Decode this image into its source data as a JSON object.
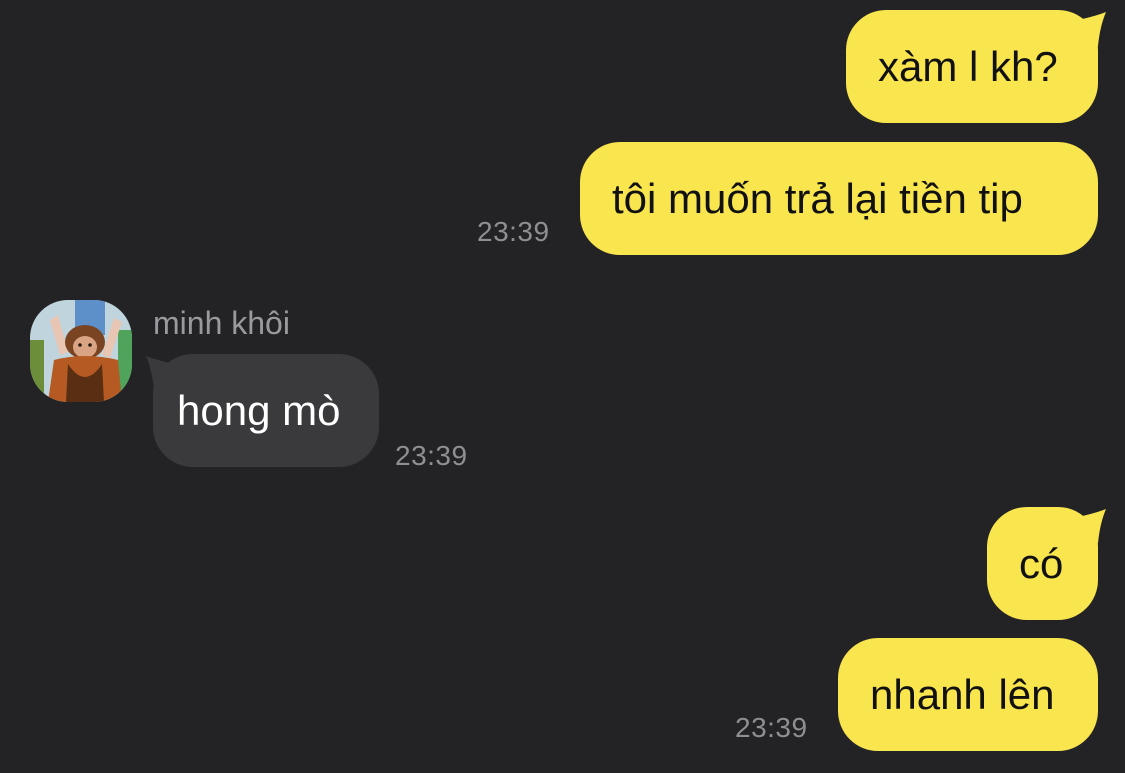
{
  "colors": {
    "background": "#232325",
    "outgoing_bubble": "#F9E54E",
    "incoming_bubble": "#3A3A3C",
    "timestamp": "#8E8E93"
  },
  "messages": [
    {
      "direction": "outgoing",
      "text": "xàm l kh?"
    },
    {
      "direction": "outgoing",
      "text": "tôi muốn trả lại tiền tip",
      "time": "23:39"
    },
    {
      "direction": "incoming",
      "sender": "minh khôi",
      "avatar_icon": "child-in-costume-avatar",
      "text": "hong mò",
      "time": "23:39"
    },
    {
      "direction": "outgoing",
      "text": "có"
    },
    {
      "direction": "outgoing",
      "text": "nhanh lên",
      "time": "23:39"
    }
  ]
}
